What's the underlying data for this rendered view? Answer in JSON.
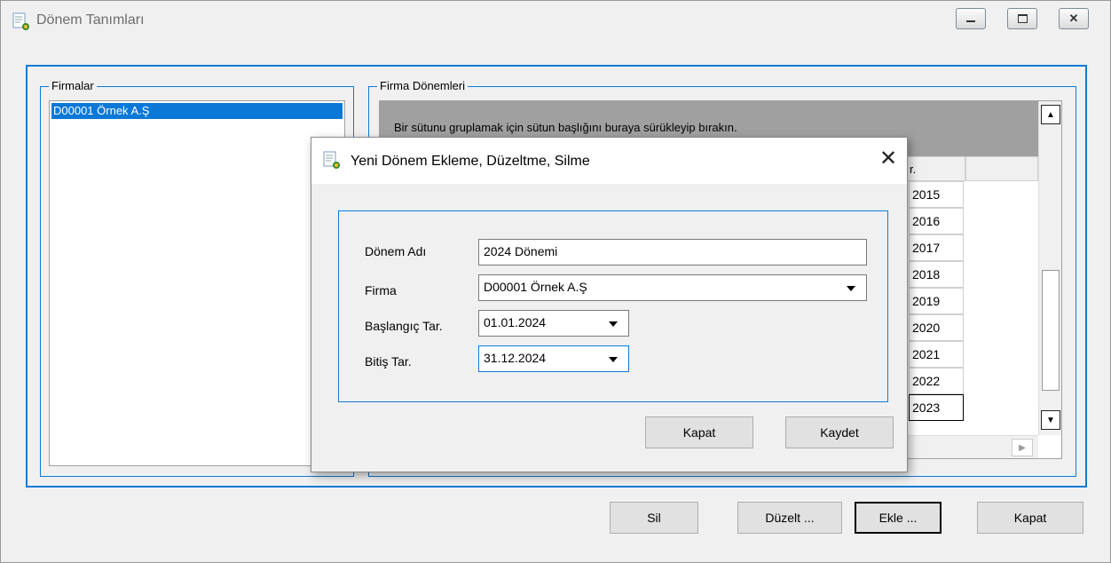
{
  "window": {
    "title": "Dönem Tanımları"
  },
  "firmalar": {
    "label": "Firmalar",
    "items": [
      "D00001  Örnek A.Ş"
    ]
  },
  "donemler": {
    "label": "Firma Dönemleri",
    "group_hint": "Bir sütunu gruplamak için sütun başlığını buraya sürükleyip bırakın.",
    "header_fragment": "r.",
    "years": [
      "2015",
      "2016",
      "2017",
      "2018",
      "2019",
      "2020",
      "2021",
      "2022",
      "2023"
    ]
  },
  "bottom_buttons": {
    "sil": "Sil",
    "duzelt": "Düzelt ...",
    "ekle": "Ekle ...",
    "kapat": "Kapat"
  },
  "dialog": {
    "title": "Yeni Dönem Ekleme, Düzeltme, Silme",
    "close_glyph": "✕",
    "fields": {
      "donem_adi": {
        "label": "Dönem Adı",
        "value": "2024 Dönemi"
      },
      "firma": {
        "label": "Firma",
        "value": "D00001  Örnek A.Ş"
      },
      "baslangic": {
        "label": "Başlangıç Tar.",
        "value": "01.01.2024"
      },
      "bitis": {
        "label": "Bitiş Tar.",
        "value": "31.12.2024"
      }
    },
    "buttons": {
      "kapat": "Kapat",
      "kaydet": "Kaydet"
    }
  },
  "icons": {
    "app": "app-icon",
    "minimize": "minimize-icon",
    "maximize": "maximize-icon",
    "close": "close-icon"
  },
  "colors": {
    "accent": "#0f7ad6",
    "selection": "#0a78d7",
    "group_panel": "#a0a0a0"
  }
}
